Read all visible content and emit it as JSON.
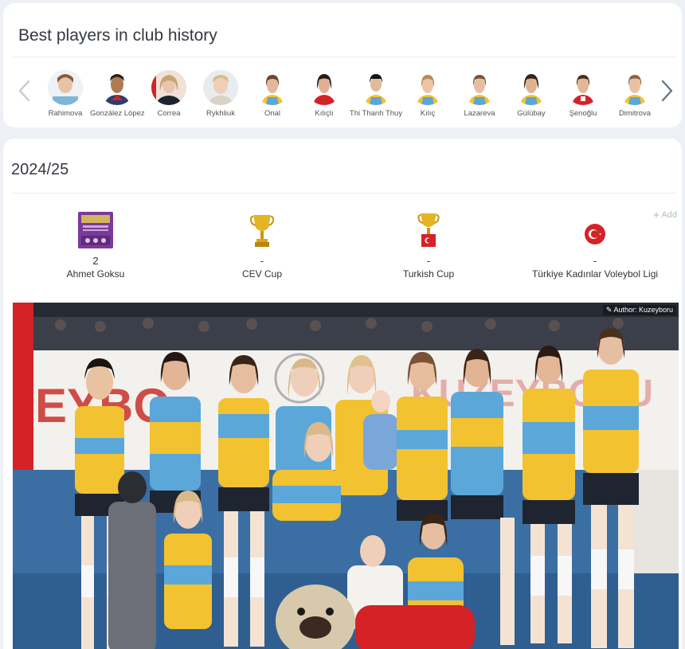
{
  "best_players": {
    "title": "Best players in club history",
    "players": [
      {
        "name": "Rahimova"
      },
      {
        "name": "González López"
      },
      {
        "name": "Correa"
      },
      {
        "name": "Rykhliuk"
      },
      {
        "name": "Onal"
      },
      {
        "name": "Kılıçlı"
      },
      {
        "name": "Thi Thanh Thuy"
      },
      {
        "name": "Kılıç"
      },
      {
        "name": "Lazareva"
      },
      {
        "name": "Gülübay"
      },
      {
        "name": "Şenoğlu"
      },
      {
        "name": "Dimitrova"
      }
    ]
  },
  "season": {
    "title": "2024/25",
    "add_label": "Add",
    "trophies": [
      {
        "count": "2",
        "label": "Ahmet Goksu"
      },
      {
        "count": "-",
        "label": "CEV Cup"
      },
      {
        "count": "-",
        "label": "Turkish Cup"
      },
      {
        "count": "-",
        "label": "Türkiye Kadınlar Voleybol Ligi"
      }
    ],
    "photo_credit": "Author: Kuzeyboru"
  },
  "colors": {
    "jersey_yellow": "#f2c230",
    "jersey_blue": "#5ba7da",
    "accent_red": "#d42227"
  }
}
